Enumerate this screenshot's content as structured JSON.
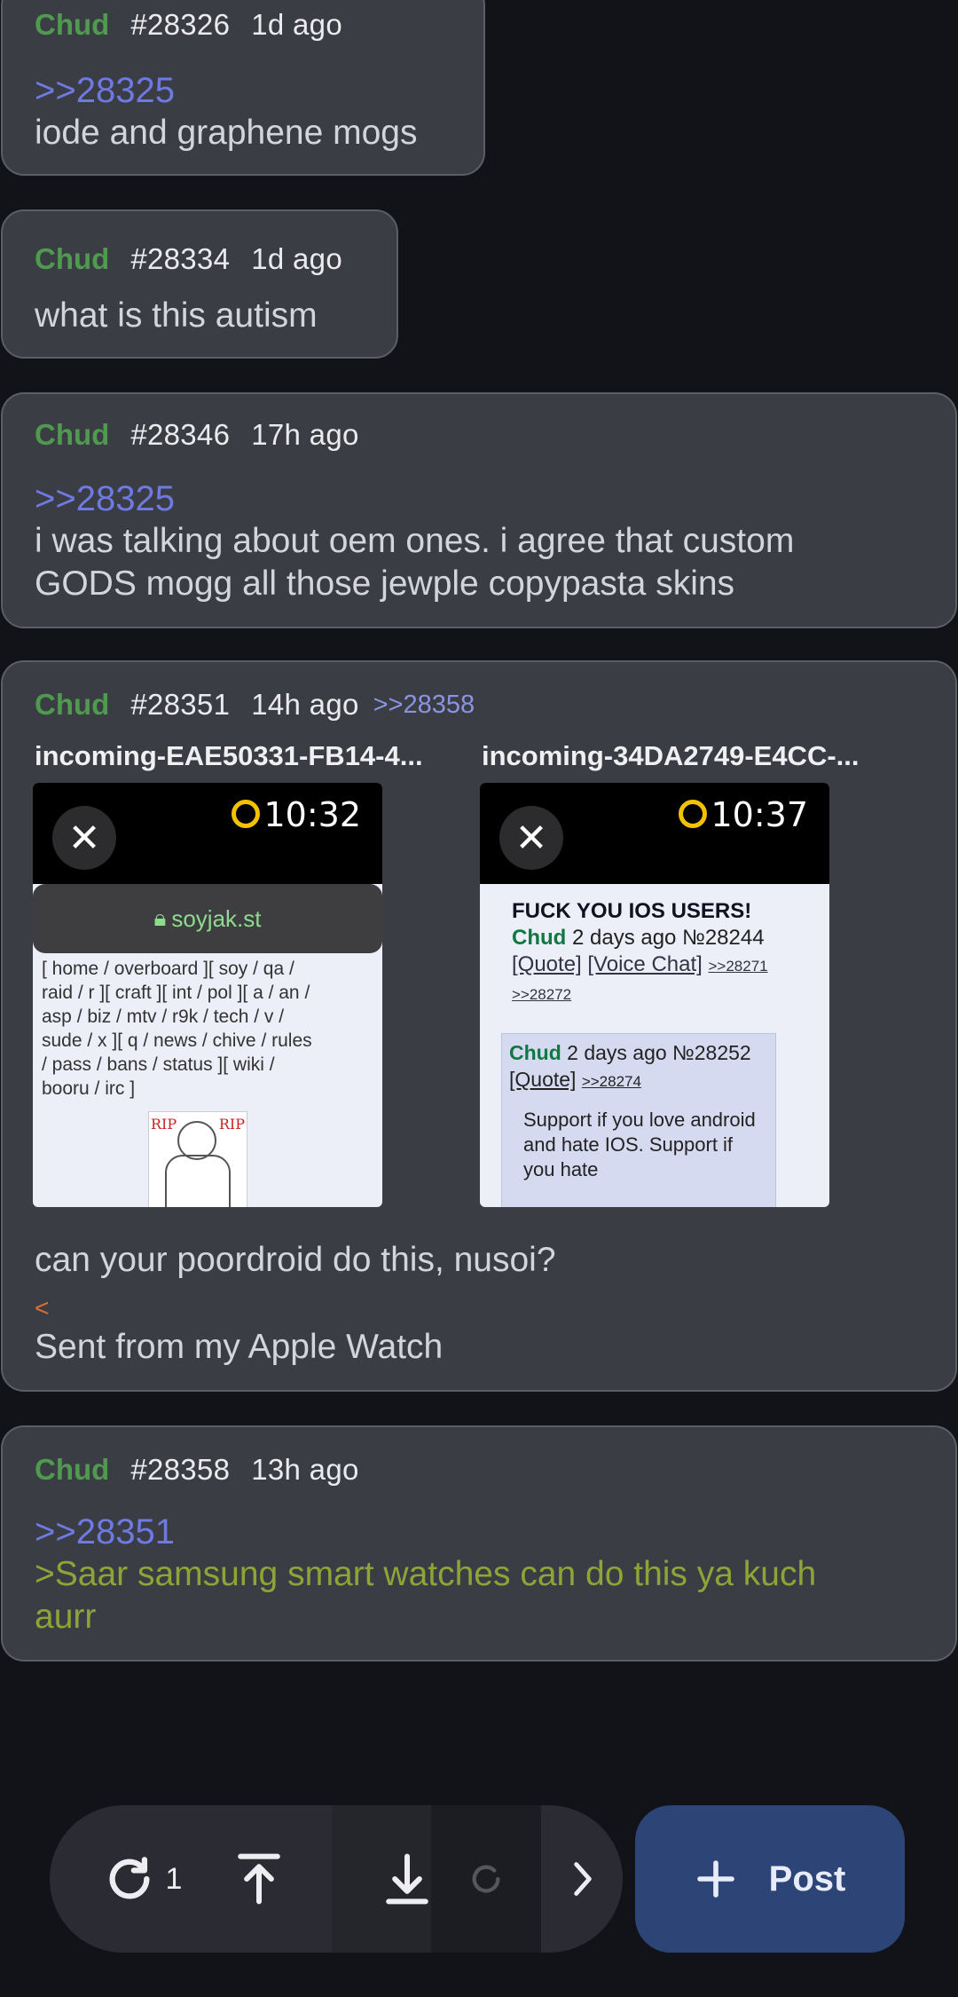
{
  "posts": [
    {
      "name": "Chud",
      "num": "#28326",
      "ago": "1d ago",
      "quote": ">>28325",
      "lines": [
        "iode and graphene mogs"
      ]
    },
    {
      "name": "Chud",
      "num": "#28334",
      "ago": "1d ago",
      "lines": [
        "what is this autism"
      ]
    },
    {
      "name": "Chud",
      "num": "#28346",
      "ago": "17h ago",
      "quote": ">>28325",
      "lines": [
        "i was talking about oem ones. i agree that custom",
        "GODS mogg all those jewple copypasta skins"
      ]
    },
    {
      "name": "Chud",
      "num": "#28351",
      "ago": "14h ago",
      "reply": ">>28358",
      "files": [
        "incoming-EAE50331-FB14-4...",
        "incoming-34DA2749-E4CC-..."
      ],
      "lines": [
        "can your poordroid do this, nusoi?",
        "<",
        "Sent from my Apple Watch"
      ]
    },
    {
      "name": "Chud",
      "num": "#28358",
      "ago": "13h ago",
      "quote": ">>28351",
      "lines": [
        ">Saar samsung smart watches can do this ya kuch",
        "aurr"
      ]
    }
  ],
  "thumb1": {
    "time": "10:32",
    "url": "soyjak.st",
    "nav": "[ home / overboard ][ soy / qa /\nraid / r ][ craft ][ int / pol ][ a / an /\nasp / biz / mtv / r9k / tech / v /\nsude / x ][ q / news / chive / rules\n/ pass / bans / status ][ wiki /\nbooru / irc ]",
    "rip_left": "RIP",
    "rip_right": "RIP"
  },
  "thumb2": {
    "time": "10:37",
    "title": "FUCK YOU IOS USERS!",
    "name": "Chud",
    "when": "2 days ago",
    "no": "№28244",
    "quote_link": "[Quote]",
    "voice": "[Voice Chat]",
    "backlinks": ">>28271 >>28272",
    "inner_name": "Chud",
    "inner_when": "2 days ago",
    "inner_no": "№28252",
    "inner_quote": "[Quote]",
    "inner_back": ">>28274",
    "inner_text": "Support if you love android and hate IOS. Support if you hate"
  },
  "toolbar": {
    "refresh_count": "1",
    "post_label": "Post"
  }
}
